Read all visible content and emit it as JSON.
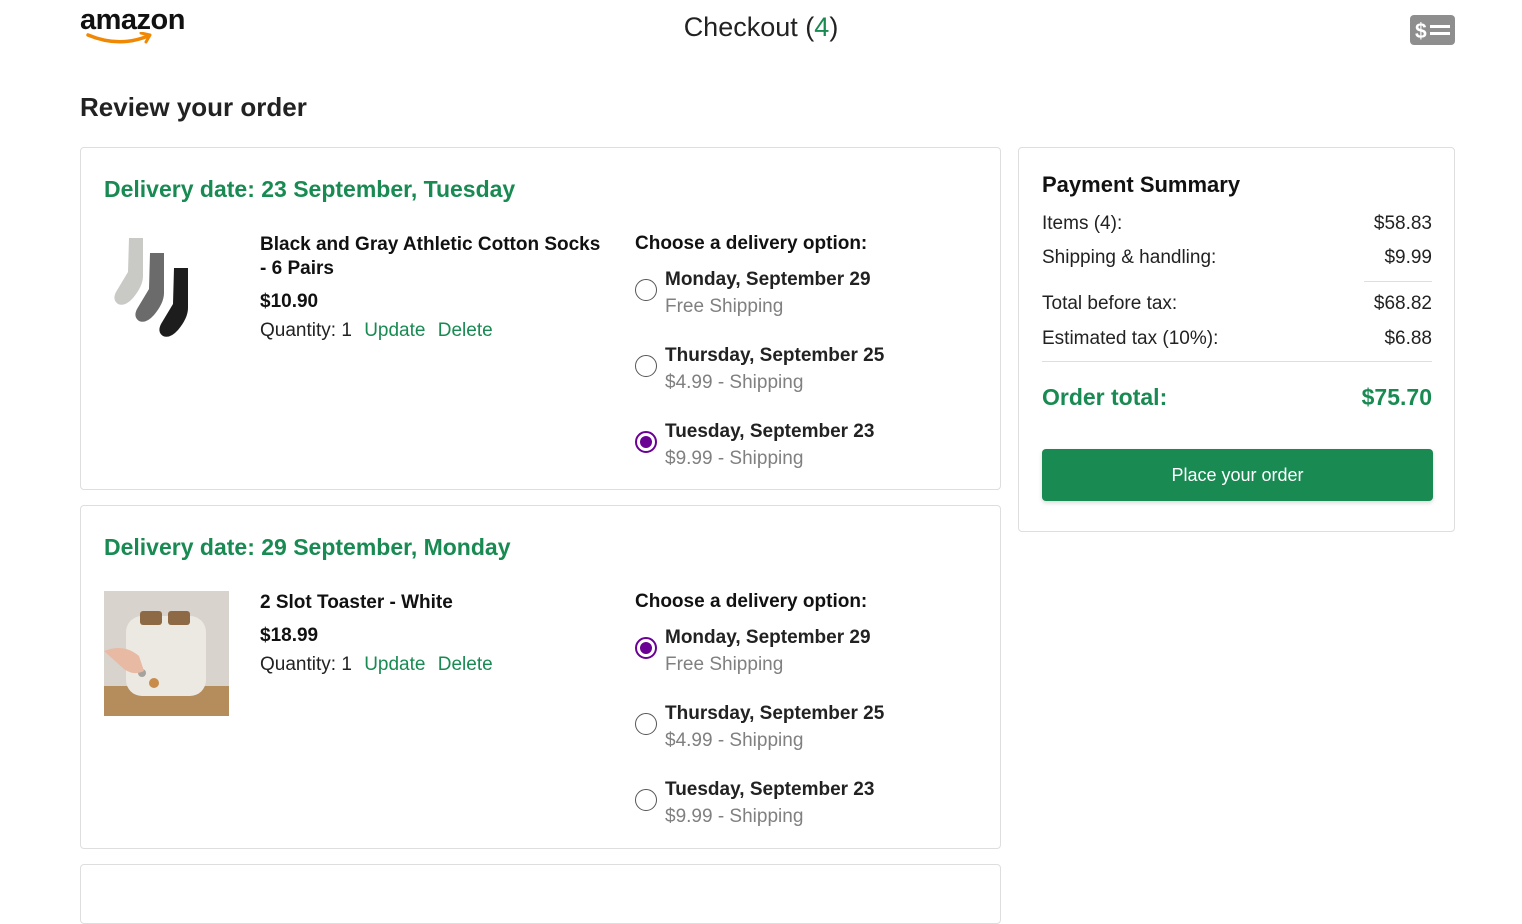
{
  "header": {
    "logo_text": "amazon",
    "checkout_label": "Checkout",
    "open_paren": "(",
    "item_count": "4",
    "close_paren": ")",
    "checkout_icon": "dollar-lines-icon"
  },
  "page_title": "Review your order",
  "orders": [
    {
      "delivery_date": "Delivery date: 23 September, Tuesday",
      "product_name": "Black and Gray Athletic Cotton Socks - 6 Pairs",
      "price": "$10.90",
      "quantity_label": "Quantity:",
      "quantity": "1",
      "update_label": "Update",
      "delete_label": "Delete",
      "options_heading": "Choose a delivery option:",
      "options": [
        {
          "date": "Monday, September 29",
          "price": "Free Shipping",
          "selected": false
        },
        {
          "date": "Thursday, September 25",
          "price": "$4.99 - Shipping",
          "selected": false
        },
        {
          "date": "Tuesday, September 23",
          "price": "$9.99 - Shipping",
          "selected": true
        }
      ]
    },
    {
      "delivery_date": "Delivery date: 29 September, Monday",
      "product_name": "2 Slot Toaster - White",
      "price": "$18.99",
      "quantity_label": "Quantity:",
      "quantity": "1",
      "update_label": "Update",
      "delete_label": "Delete",
      "options_heading": "Choose a delivery option:",
      "options": [
        {
          "date": "Monday, September 29",
          "price": "Free Shipping",
          "selected": true
        },
        {
          "date": "Thursday, September 25",
          "price": "$4.99 - Shipping",
          "selected": false
        },
        {
          "date": "Tuesday, September 23",
          "price": "$9.99 - Shipping",
          "selected": false
        }
      ]
    }
  ],
  "summary": {
    "title": "Payment Summary",
    "items_label": "Items (4):",
    "items_value": "$58.83",
    "shipping_label": "Shipping & handling:",
    "shipping_value": "$9.99",
    "before_tax_label": "Total before tax:",
    "before_tax_value": "$68.82",
    "tax_label": "Estimated tax (10%):",
    "tax_value": "$6.88",
    "total_label": "Order total:",
    "total_value": "$75.70",
    "place_order_label": "Place your order"
  },
  "colors": {
    "accent_green": "#188a52",
    "radio_purple": "#6a0094",
    "muted_text": "#808080"
  }
}
